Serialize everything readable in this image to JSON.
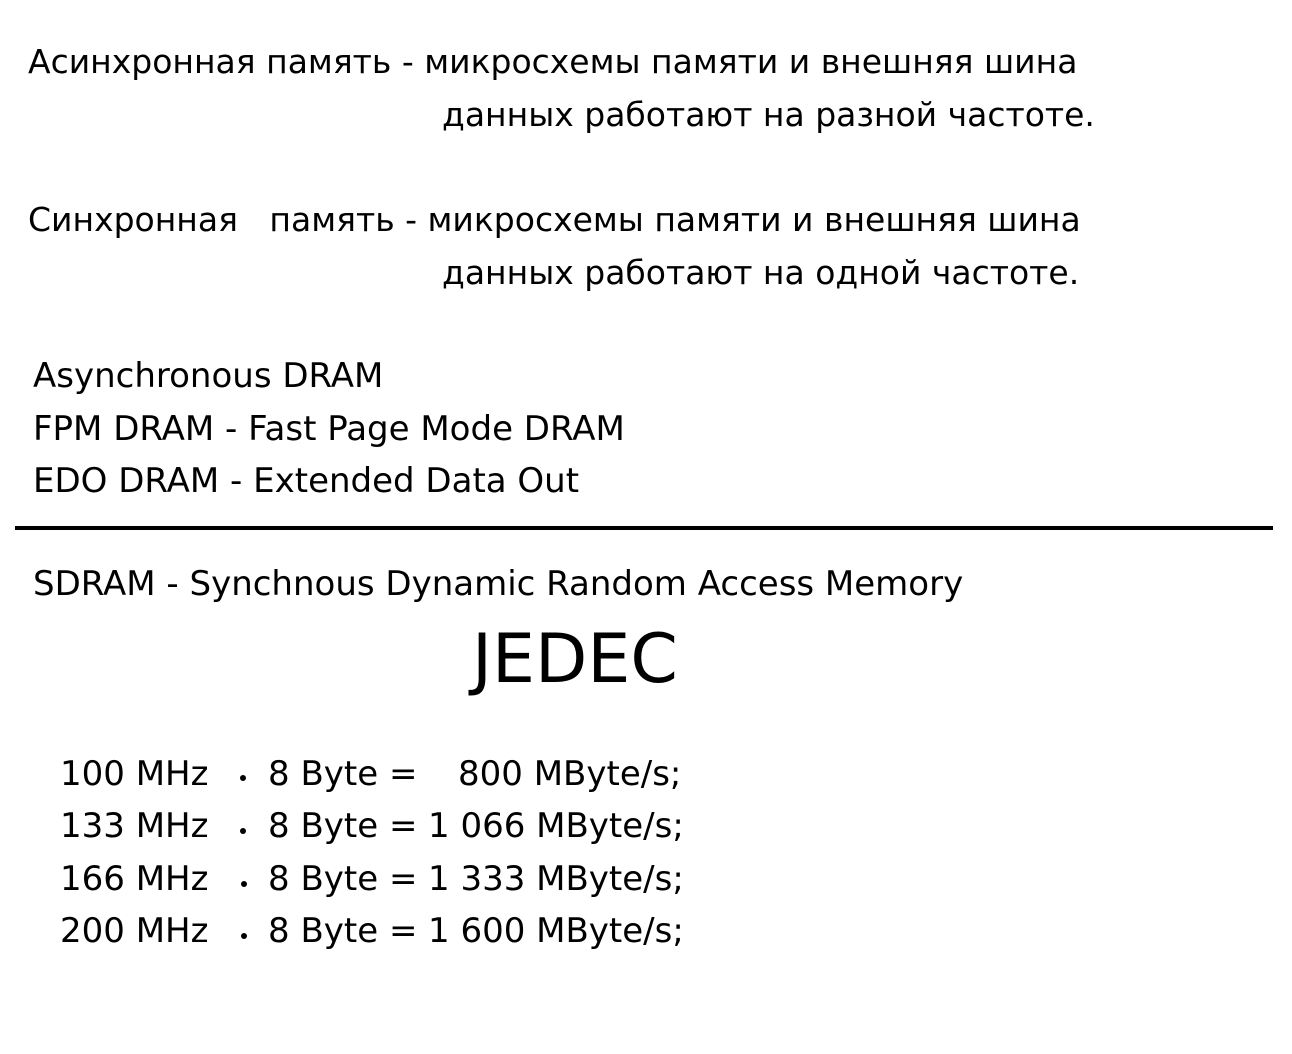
{
  "definitions": {
    "async_line1": "Асинхронная память - микросхемы памяти и внешняя шина",
    "async_line2": "данных работают на разной частоте.",
    "sync_line1": "Синхронная   память - микросхемы памяти и внешняя шина",
    "sync_line2": "данных работают на одной частоте."
  },
  "async_list": {
    "item1": "Asynchronous DRAM",
    "item2": "FPM DRAM - Fast Page Mode DRAM",
    "item3": "EDO DRAM - Extended Data Out"
  },
  "sdram": {
    "definition": "SDRAM - Synchnous Dynamic Random Access Memory",
    "standard": "JEDEC"
  },
  "bandwidth": [
    {
      "freq": "100 MHz",
      "width": "8 Byte =",
      "result": "800 MByte/s;"
    },
    {
      "freq": "133 MHz",
      "width": "8 Byte =",
      "result": "1 066 MByte/s;"
    },
    {
      "freq": "166 MHz",
      "width": "8 Byte =",
      "result": "1 333 MByte/s;"
    },
    {
      "freq": "200 MHz",
      "width": "8 Byte =",
      "result": "1 600 MByte/s;"
    }
  ]
}
